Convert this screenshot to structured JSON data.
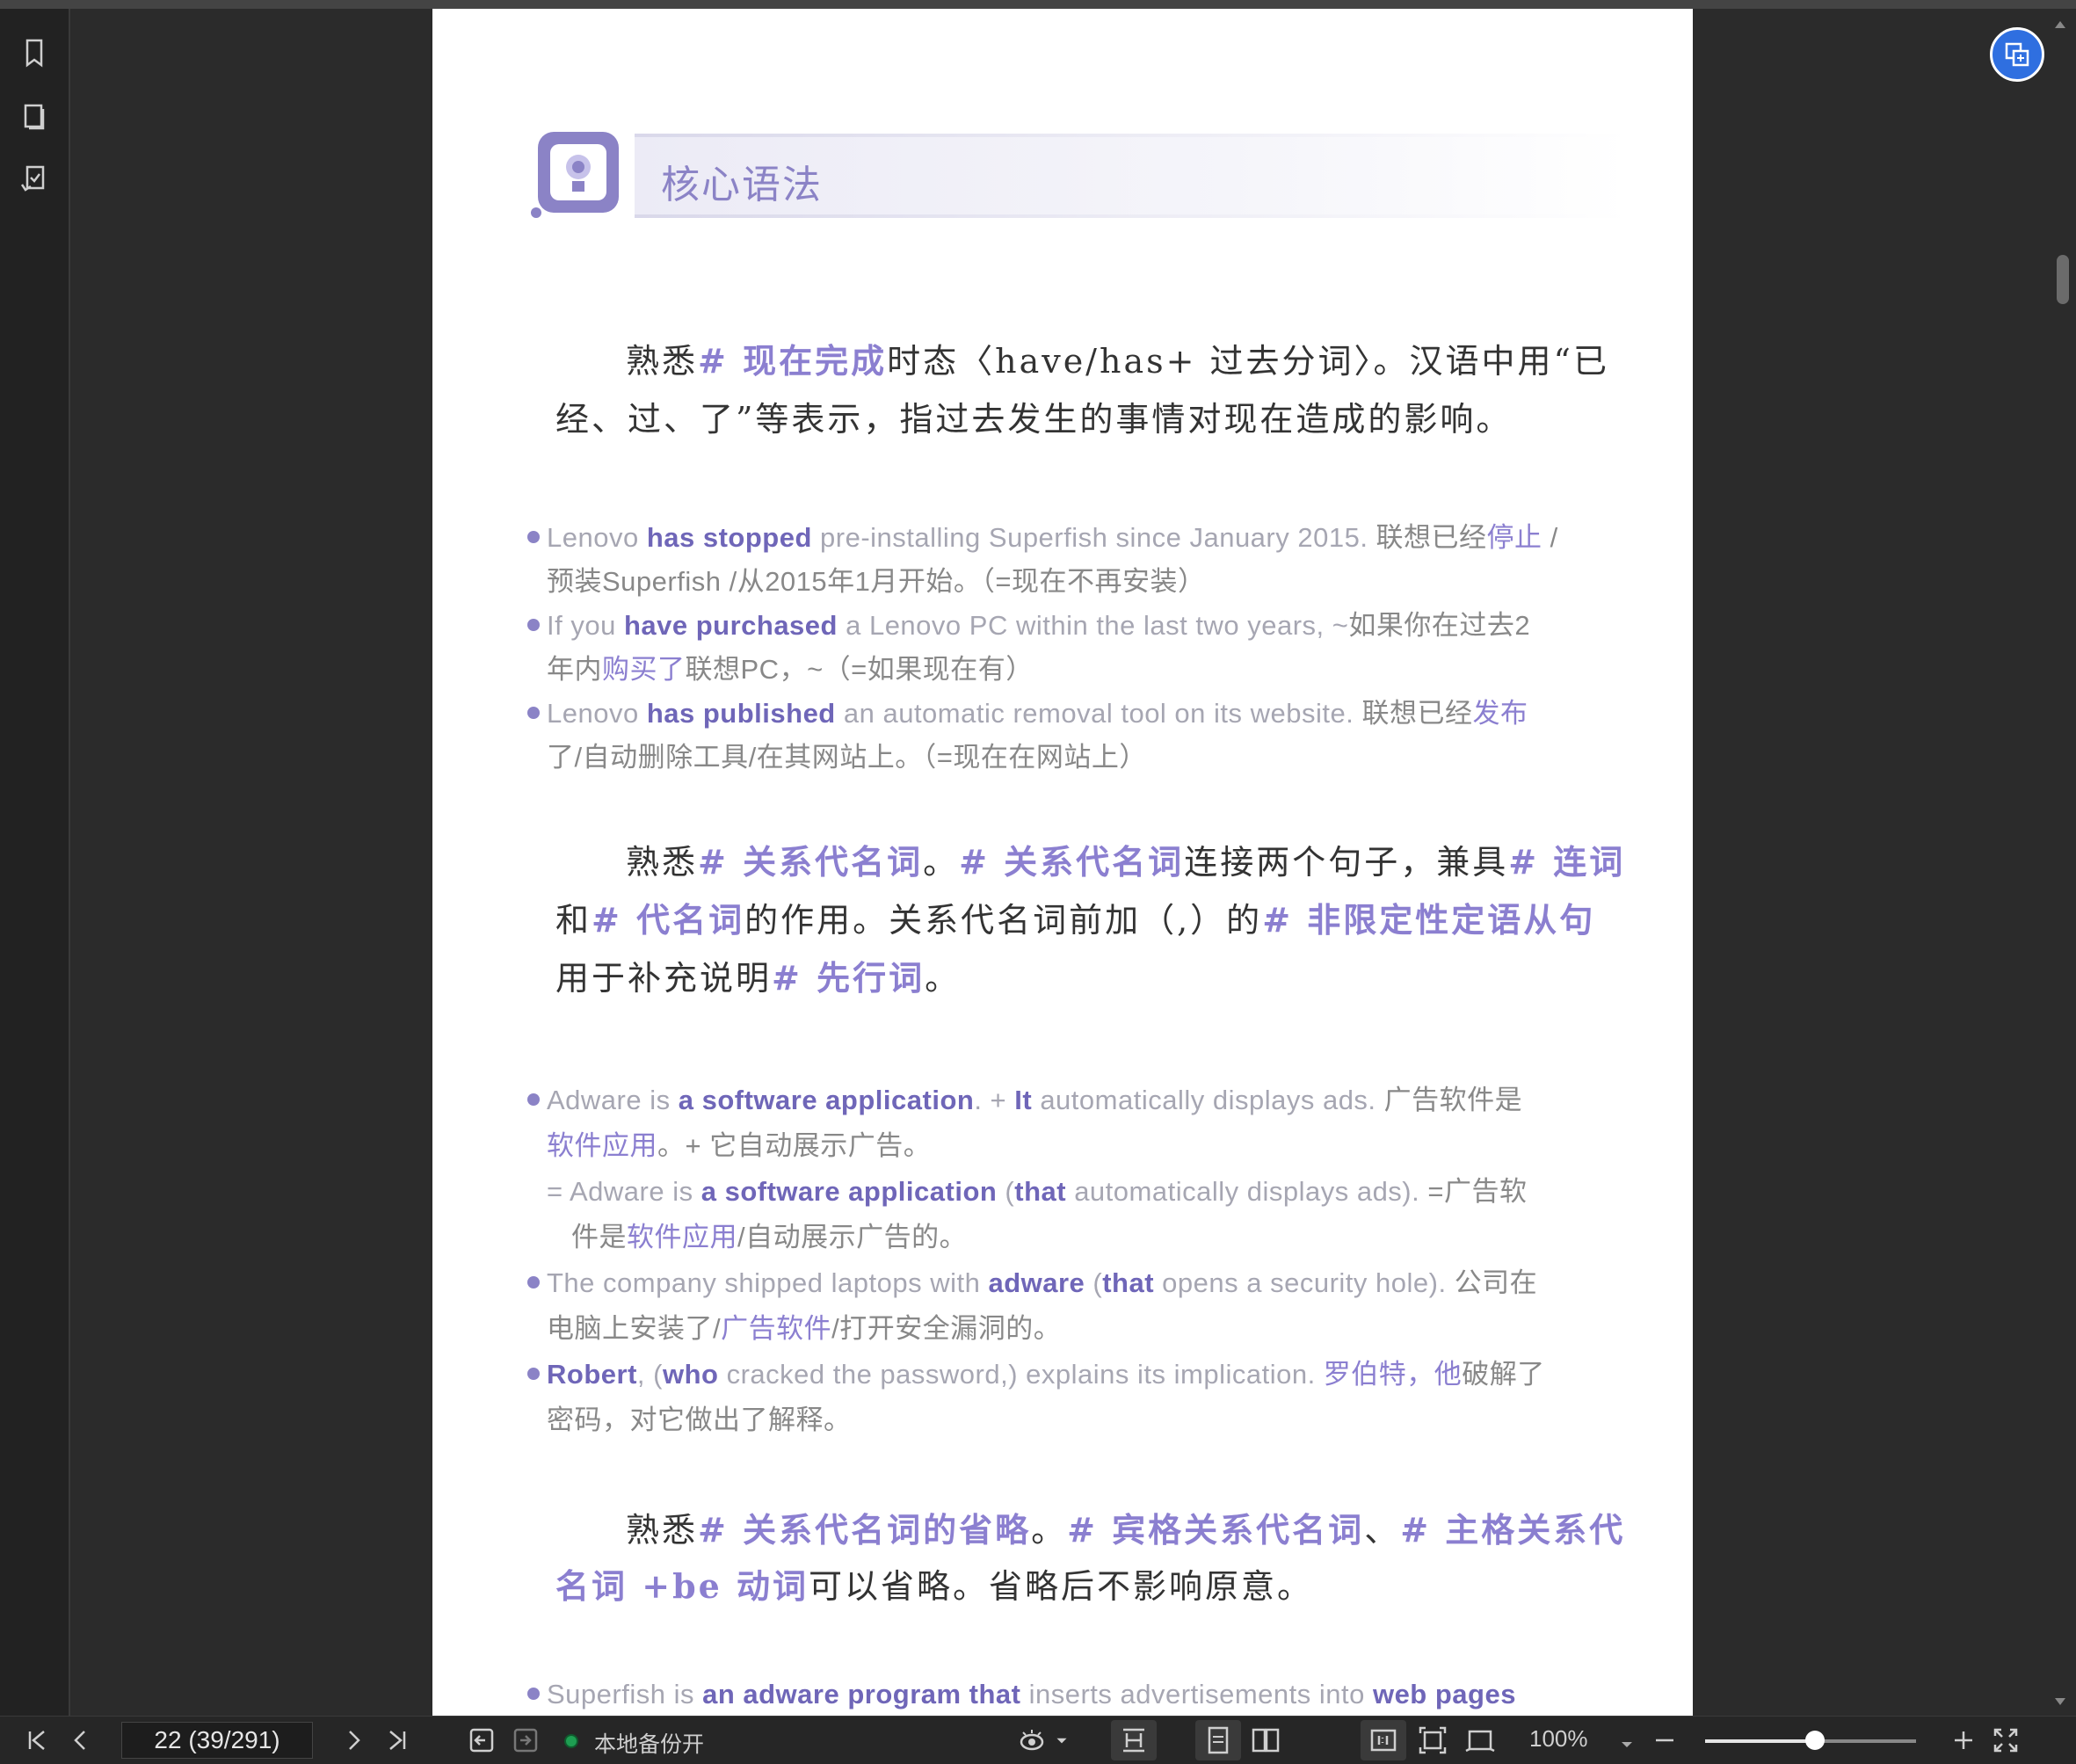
{
  "sidebar": {
    "icons": [
      "bookmark-icon",
      "thumbnail-icon",
      "annotation-export-icon"
    ]
  },
  "page": {
    "header_title": "核心语法",
    "section1": {
      "lines": [
        [
          [
            "熟悉",
            ""
          ],
          [
            "# 现在完成",
            "hl"
          ],
          [
            "时态〈have/has+ 过去分词〉。汉语中用“已",
            ""
          ]
        ],
        [
          [
            "经、过、了”等表示，指过去发生的事情对现在造成的影响。",
            ""
          ]
        ]
      ]
    },
    "examples1": [
      [
        [
          "Lenovo ",
          ""
        ],
        [
          "has stopped",
          "b"
        ],
        [
          " pre-installing Superfish since January 2015.  ",
          ""
        ],
        [
          "联想已经",
          "zh"
        ],
        [
          "停止",
          "zhp"
        ],
        [
          " /",
          "zh"
        ]
      ],
      [
        [
          "预装Superfish  /从2015年1月开始。（=现在不再安装）",
          "zh"
        ]
      ],
      [
        [
          "If you ",
          ""
        ],
        [
          "have purchased",
          "b"
        ],
        [
          " a Lenovo PC within the last two years, ~",
          ""
        ],
        [
          "如果你在过去2",
          "zh"
        ]
      ],
      [
        [
          "年内",
          "zh"
        ],
        [
          "购买了",
          "zhp"
        ],
        [
          "联想PC，~（=如果现在有）",
          "zh"
        ]
      ],
      [
        [
          "Lenovo ",
          ""
        ],
        [
          "has published",
          "b"
        ],
        [
          " an automatic removal tool on its website.  ",
          ""
        ],
        [
          "联想已经",
          "zh"
        ],
        [
          "发布",
          "zhp"
        ]
      ],
      [
        [
          "了/自动删除工具/在其网站上。（=现在在网站上）",
          "zh"
        ]
      ]
    ],
    "section2": {
      "lines": [
        [
          [
            "熟悉",
            ""
          ],
          [
            "# 关系代名词",
            "hl"
          ],
          [
            "。",
            ""
          ],
          [
            "# 关系代名词",
            "hl"
          ],
          [
            "连接两个句子，兼具",
            ""
          ],
          [
            "# 连词",
            "hl"
          ]
        ],
        [
          [
            "和",
            ""
          ],
          [
            "# 代名词",
            "hl"
          ],
          [
            "的作用。关系代名词前加（,）的",
            ""
          ],
          [
            "# 非限定性定语从句",
            "hl"
          ]
        ],
        [
          [
            "用于补充说明",
            ""
          ],
          [
            "# 先行词",
            "hl"
          ],
          [
            "。",
            ""
          ]
        ]
      ]
    },
    "examples2": [
      [
        [
          "Adware is ",
          ""
        ],
        [
          "a software application",
          "b"
        ],
        [
          ". + ",
          ""
        ],
        [
          "It",
          "b"
        ],
        [
          " automatically displays ads.  ",
          ""
        ],
        [
          "广告软件是",
          "zh"
        ]
      ],
      [
        [
          "软件应用",
          "zhp"
        ],
        [
          "。+ 它自动展示广告。",
          "zh"
        ]
      ],
      [
        [
          "= Adware is ",
          ""
        ],
        [
          "a software application",
          "b"
        ],
        [
          " (",
          ""
        ],
        [
          "that",
          "b"
        ],
        [
          " automatically displays ads).  ",
          ""
        ],
        [
          "=广告软",
          "zh"
        ]
      ],
      [
        [
          "件是",
          "zh"
        ],
        [
          "软件应用",
          "zhp"
        ],
        [
          "/自动展示广告的。",
          "zh"
        ]
      ],
      [
        [
          "The company shipped laptops with ",
          ""
        ],
        [
          "adware",
          "b"
        ],
        [
          " (",
          ""
        ],
        [
          "that",
          "b"
        ],
        [
          " opens a security hole).  ",
          ""
        ],
        [
          "公司在",
          "zh"
        ]
      ],
      [
        [
          "电脑上安装了/",
          "zh"
        ],
        [
          "广告软件",
          "zhp"
        ],
        [
          "/打开安全漏洞的。",
          "zh"
        ]
      ],
      [
        [
          "Robert",
          "b"
        ],
        [
          ", (",
          ""
        ],
        [
          "who",
          "b"
        ],
        [
          " cracked the password,) explains its implication.  ",
          ""
        ],
        [
          "罗伯特，他",
          "zhp"
        ],
        [
          "破解了",
          "zh"
        ]
      ],
      [
        [
          "密码，对它做出了解释。",
          "zh"
        ]
      ]
    ],
    "section3": {
      "lines": [
        [
          [
            "熟悉",
            ""
          ],
          [
            "# 关系代名词的省略",
            "hl"
          ],
          [
            "。",
            ""
          ],
          [
            "# 宾格关系代名词",
            "hl"
          ],
          [
            "、",
            ""
          ],
          [
            "# 主格关系代",
            "hl"
          ]
        ],
        [
          [
            "名词 +be 动词",
            "hl"
          ],
          [
            "可以省略。省略后不影响原意。",
            ""
          ]
        ]
      ]
    },
    "examples3": [
      [
        [
          "Superfish is ",
          ""
        ],
        [
          "an adware program that",
          "b"
        ],
        [
          " inserts advertisements into ",
          ""
        ],
        [
          "web pages",
          "b"
        ]
      ]
    ]
  },
  "toolbar": {
    "page_indicator": "22 (39/291)",
    "status": "本地备份开",
    "zoom": "100%",
    "zoom_fraction": 0.52
  },
  "colors": {
    "accent": "#8b7fd0",
    "floating_button": "#2f6fe0",
    "status_ok": "#1e9e52"
  }
}
